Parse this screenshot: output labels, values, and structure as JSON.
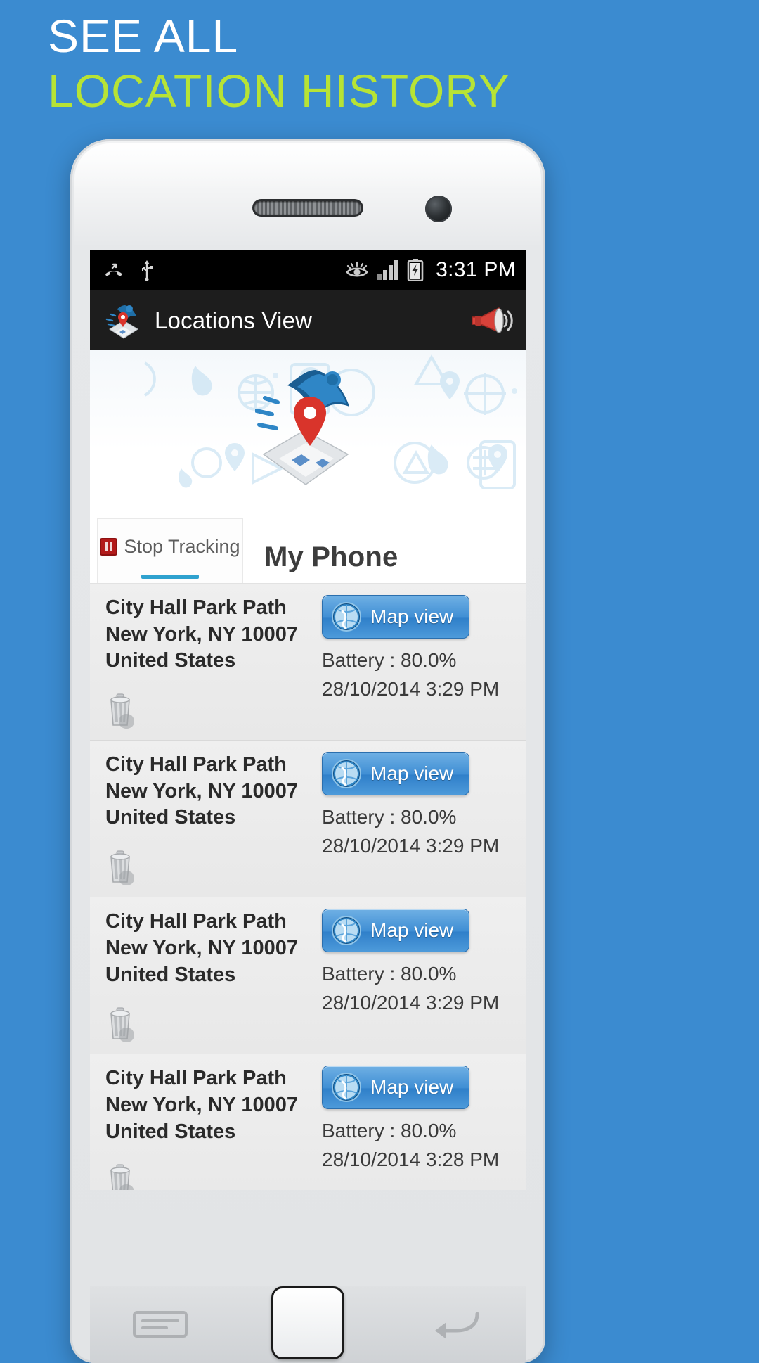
{
  "promo": {
    "line1": "SEE ALL",
    "line2": "LOCATION HISTORY",
    "line1_color": "#ffffff",
    "line2_color": "#b7e335",
    "background_color": "#3b8bd0"
  },
  "statusbar": {
    "time": "3:31 PM",
    "icons_left": [
      "missed-call-icon",
      "usb-icon"
    ],
    "icons_right": [
      "eye-icon",
      "signal-bars-icon",
      "battery-charging-icon"
    ]
  },
  "actionbar": {
    "app_icon": "locations-map-logo-icon",
    "title": "Locations View",
    "right_icon": "megaphone-icon"
  },
  "banner": {
    "logo_icon": "map-pin-person-logo-icon"
  },
  "tabs": [
    {
      "label": "Stop Tracking",
      "icon": "pause-icon",
      "selected": true
    }
  ],
  "device_header": {
    "name": "My Phone"
  },
  "list": {
    "map_view_label": "Map view",
    "map_view_icon": "globe-icon",
    "delete_icon": "trash-icon",
    "rows": [
      {
        "address_line1": "City Hall Park Path",
        "address_line2": "New York, NY 10007",
        "address_line3": "United States",
        "battery": "Battery : 80.0%",
        "timestamp": "28/10/2014 3:29 PM"
      },
      {
        "address_line1": "City Hall Park Path",
        "address_line2": "New York, NY 10007",
        "address_line3": "United States",
        "battery": "Battery : 80.0%",
        "timestamp": "28/10/2014 3:29 PM"
      },
      {
        "address_line1": "City Hall Park Path",
        "address_line2": "New York, NY 10007",
        "address_line3": "United States",
        "battery": "Battery : 80.0%",
        "timestamp": "28/10/2014 3:29 PM"
      },
      {
        "address_line1": "City Hall Park Path",
        "address_line2": "New York, NY 10007",
        "address_line3": "United States",
        "battery": "Battery : 80.0%",
        "timestamp": "28/10/2014 3:28 PM"
      }
    ]
  },
  "navbar": {
    "menu_icon": "menu-icon",
    "home_icon": "home-button-icon",
    "back_icon": "back-arrow-icon"
  }
}
